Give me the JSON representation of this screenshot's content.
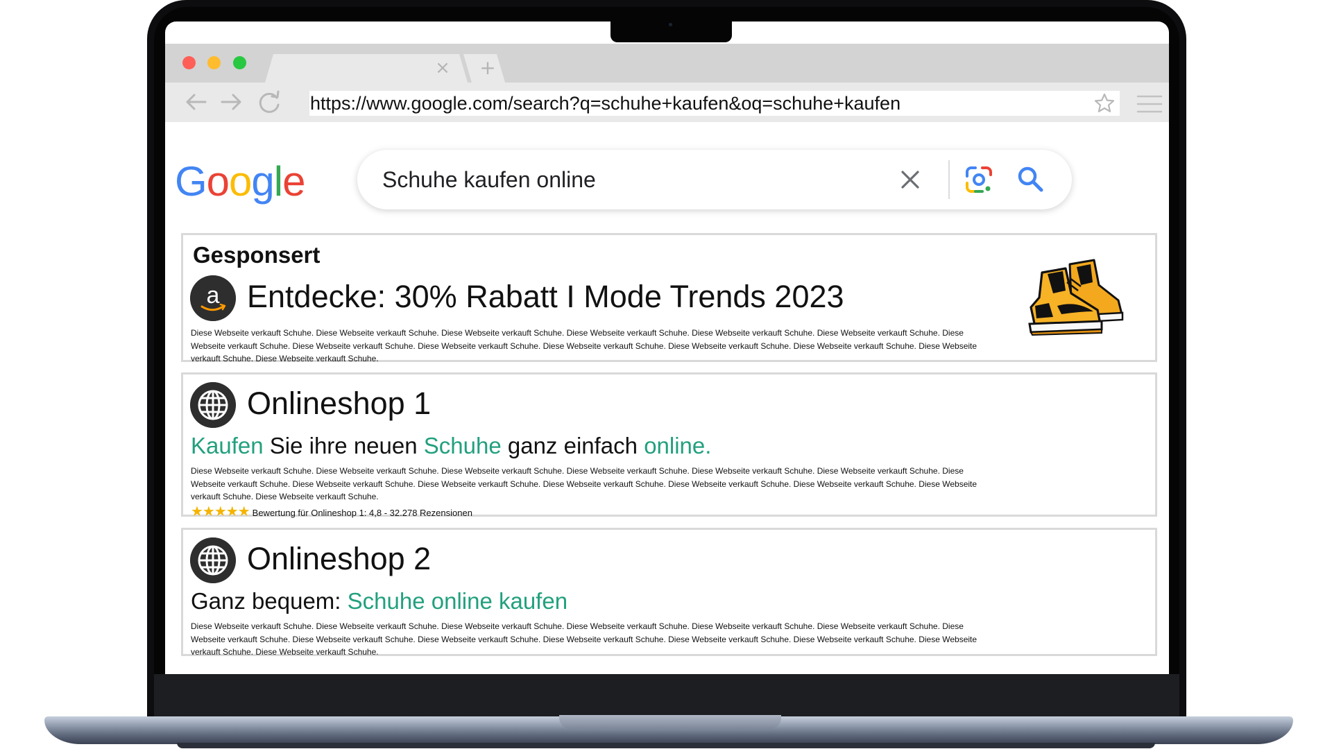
{
  "browser": {
    "url": "https://www.google.com/search?q=schuhe+kaufen&oq=schuhe+kaufen",
    "tab_close_glyph": "×",
    "new_tab_glyph": "+"
  },
  "google": {
    "logo_letters": [
      "G",
      "o",
      "o",
      "g",
      "l",
      "e"
    ],
    "logo_colors": [
      "#4285F4",
      "#EA4335",
      "#FBBC05",
      "#4285F4",
      "#34A853",
      "#EA4335"
    ],
    "search_query": "Schuhe kaufen online"
  },
  "results": {
    "ad": {
      "sponsored_label": "Gesponsert",
      "icon": "amazon-logo",
      "icon_letter": "a",
      "title": "Entdecke: 30% Rabatt I Mode Trends 2023",
      "description": "Diese Webseite verkauft Schuhe. Diese Webseite verkauft Schuhe. Diese Webseite verkauft Schuhe. Diese Webseite verkauft Schuhe. Diese Webseite verkauft Schuhe. Diese Webseite verkauft Schuhe. Diese Webseite verkauft Schuhe. Diese Webseite verkauft Schuhe. Diese Webseite verkauft Schuhe. Diese Webseite verkauft Schuhe. Diese Webseite verkauft Schuhe. Diese Webseite verkauft Schuhe. Diese Webseite verkauft Schuhe. Diese Webseite verkauft Schuhe.",
      "image": "sneaker-image"
    },
    "shop1": {
      "icon": "globe-icon",
      "title": "Onlineshop 1",
      "subtitle_parts": [
        "Kaufen",
        " Sie ihre neuen ",
        "Schuhe",
        " ganz einfach ",
        "online."
      ],
      "description": "Diese Webseite verkauft Schuhe. Diese Webseite verkauft Schuhe. Diese Webseite verkauft Schuhe. Diese Webseite verkauft Schuhe. Diese Webseite verkauft Schuhe. Diese Webseite verkauft Schuhe. Diese Webseite verkauft Schuhe. Diese Webseite verkauft Schuhe. Diese Webseite verkauft Schuhe. Diese Webseite verkauft Schuhe. Diese Webseite verkauft Schuhe. Diese Webseite verkauft Schuhe. Diese Webseite verkauft Schuhe. Diese Webseite verkauft Schuhe.",
      "stars": "★★★★★",
      "rating_value": 4.8,
      "rating_text": "Bewertung für Onlineshop 1: 4,8 - 32.278 Rezensionen"
    },
    "shop2": {
      "icon": "globe-icon",
      "title": "Onlineshop 2",
      "subtitle_plain": "Ganz bequem: ",
      "subtitle_green": "Schuhe online kaufen",
      "description": "Diese Webseite verkauft Schuhe. Diese Webseite verkauft Schuhe. Diese Webseite verkauft Schuhe. Diese Webseite verkauft Schuhe. Diese Webseite verkauft Schuhe. Diese Webseite verkauft Schuhe. Diese Webseite verkauft Schuhe. Diese Webseite verkauft Schuhe. Diese Webseite verkauft Schuhe. Diese Webseite verkauft Schuhe. Diese Webseite verkauft Schuhe. Diese Webseite verkauft Schuhe. Diese Webseite verkauft Schuhe. Diese Webseite verkauft Schuhe."
    }
  },
  "colors": {
    "highlight_green": "#22a07e",
    "star_yellow": "#f4b400",
    "card_border": "#d9d9d9"
  }
}
